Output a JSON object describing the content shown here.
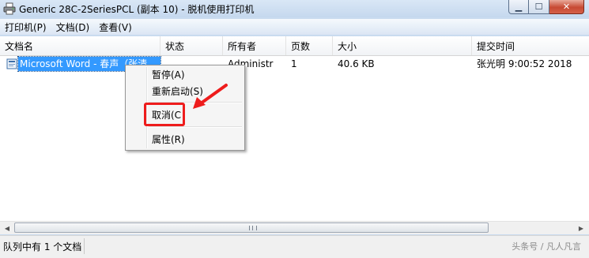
{
  "window": {
    "title": "Generic 28C-2SeriesPCL (副本 10)  - 脱机使用打印机",
    "minimize_symbol": "▁",
    "maximize_symbol": "☐",
    "close_symbol": "✕"
  },
  "menu": {
    "items": [
      "打印机(P)",
      "文档(D)",
      "查看(V)"
    ]
  },
  "list": {
    "columns": [
      "文档名",
      "状态",
      "所有者",
      "页数",
      "大小",
      "提交时间"
    ],
    "rows": [
      {
        "name": "Microsoft Word - 春声（张清",
        "status": "",
        "owner": "Administr",
        "pages": "1",
        "size": "40.6 KB",
        "submitted": "张光明 9:00:52   2018"
      }
    ]
  },
  "context_menu": {
    "items": [
      "暂停(A)",
      "重新启动(S)",
      "取消(C",
      "属性(R)"
    ]
  },
  "status": {
    "text": "队列中有 1 个文档",
    "watermark": "头条号 / 凡人凡言"
  },
  "colors": {
    "selection": "#3399ff",
    "annotation_red": "#ee1c1c",
    "window_frame": "#c9dbef"
  }
}
